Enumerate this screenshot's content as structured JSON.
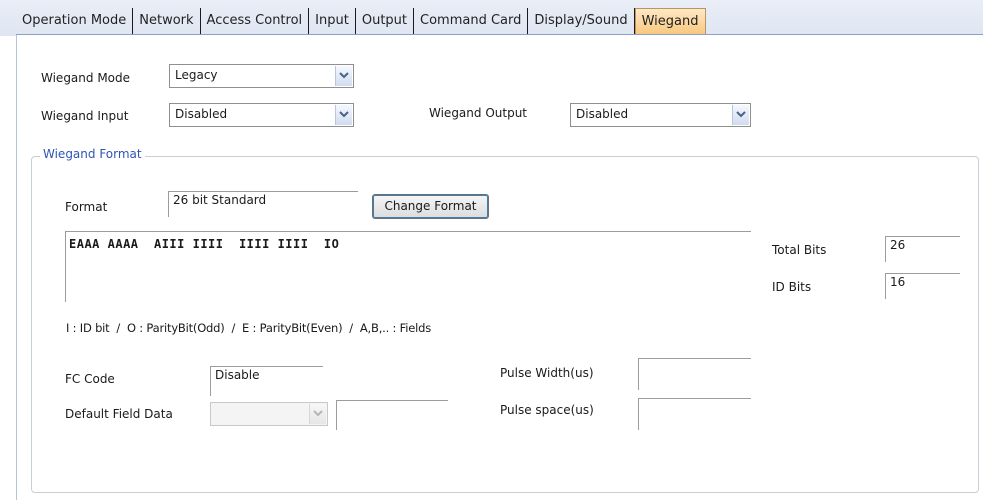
{
  "tabs": [
    {
      "label": "Operation Mode",
      "active": false
    },
    {
      "label": "Network",
      "active": false
    },
    {
      "label": "Access Control",
      "active": false
    },
    {
      "label": "Input",
      "active": false
    },
    {
      "label": "Output",
      "active": false
    },
    {
      "label": "Command Card",
      "active": false
    },
    {
      "label": "Display/Sound",
      "active": false
    },
    {
      "label": "Wiegand",
      "active": true
    }
  ],
  "wiegand_mode": {
    "label": "Wiegand Mode",
    "value": "Legacy"
  },
  "wiegand_input": {
    "label": "Wiegand Input",
    "value": "Disabled"
  },
  "wiegand_output": {
    "label": "Wiegand Output",
    "value": "Disabled"
  },
  "format_group": {
    "title": "Wiegand Format",
    "format_label": "Format",
    "format_value": "26 bit Standard",
    "change_format_button": "Change Format",
    "bit_pattern": "EAAA AAAA  AIII IIII  IIII IIII  IO",
    "total_bits_label": "Total Bits",
    "total_bits_value": "26",
    "id_bits_label": "ID Bits",
    "id_bits_value": "16",
    "legend": "I : ID bit  /  O : ParityBit(Odd)  /  E : ParityBit(Even)  /  A,B,.. : Fields",
    "fc_code_label": "FC Code",
    "fc_code_value": "Disable",
    "default_field_data_label": "Default Field Data",
    "default_field_data_value": "",
    "pulse_width_label": "Pulse Width(us)",
    "pulse_width_value": "",
    "pulse_space_label": "Pulse space(us)",
    "pulse_space_value": ""
  },
  "colors": {
    "active_tab": "#f8c880",
    "group_title": "#2f55b4",
    "tab_strip": "#e3e9f4"
  },
  "icons": {
    "combo_arrow": "chevron-down-icon"
  }
}
